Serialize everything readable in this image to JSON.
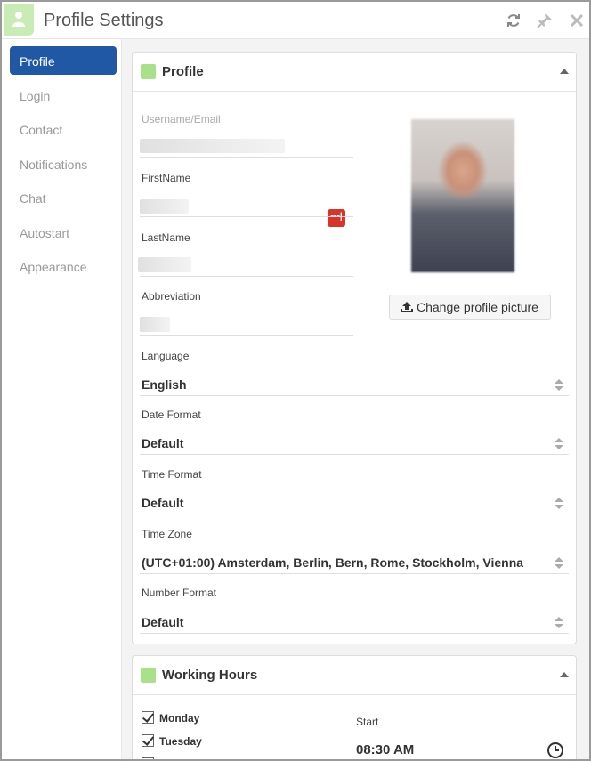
{
  "window": {
    "title": "Profile Settings"
  },
  "sidebar": {
    "items": [
      {
        "label": "Profile",
        "active": true
      },
      {
        "label": "Login"
      },
      {
        "label": "Contact"
      },
      {
        "label": "Notifications"
      },
      {
        "label": "Chat"
      },
      {
        "label": "Autostart"
      },
      {
        "label": "Appearance"
      }
    ]
  },
  "profile": {
    "title": "Profile",
    "username_label": "Username/Email",
    "firstname_label": "FirstName",
    "lastname_label": "LastName",
    "abbreviation_label": "Abbreviation",
    "change_picture_label": "Change profile picture",
    "language": {
      "label": "Language",
      "value": "English"
    },
    "date_format": {
      "label": "Date Format",
      "value": "Default"
    },
    "time_format": {
      "label": "Time Format",
      "value": "Default"
    },
    "time_zone": {
      "label": "Time Zone",
      "value": "(UTC+01:00) Amsterdam, Berlin, Bern, Rome, Stockholm, Vienna"
    },
    "number_format": {
      "label": "Number Format",
      "value": "Default"
    }
  },
  "working_hours": {
    "title": "Working Hours",
    "days": [
      {
        "label": "Monday",
        "checked": true
      },
      {
        "label": "Tuesday",
        "checked": true
      }
    ],
    "start_label": "Start",
    "start_value": "08:30 AM"
  },
  "colors": {
    "accent": "#2158a6",
    "section": "#a9e08a",
    "danger": "#d9342b"
  },
  "icons": [
    "user-icon",
    "refresh-icon",
    "pin-icon",
    "close-icon",
    "upload-icon",
    "more-icon",
    "clock-icon"
  ]
}
